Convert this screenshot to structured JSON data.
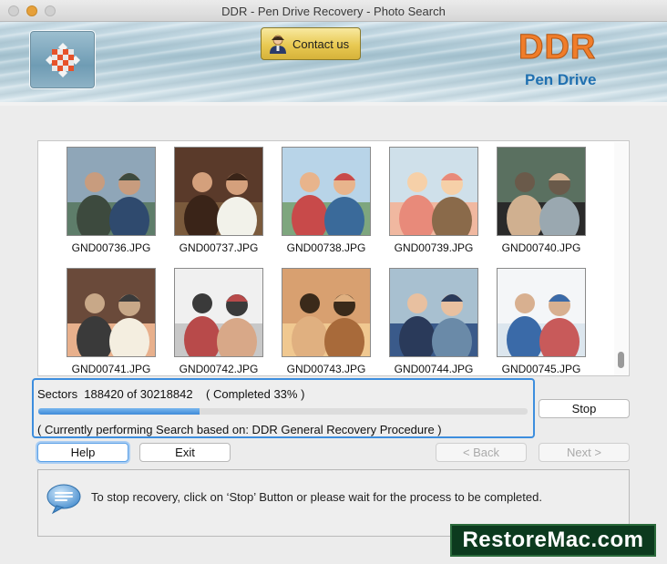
{
  "window": {
    "title": "DDR - Pen Drive Recovery - Photo Search"
  },
  "banner": {
    "contact_label": "Contact us",
    "brand": "DDR",
    "brand_sub": "Pen Drive"
  },
  "gallery": {
    "items": [
      {
        "label": "GND00736.JPG",
        "icon": "photo-two-men-outdoors"
      },
      {
        "label": "GND00737.JPG",
        "icon": "photo-smiling-woman"
      },
      {
        "label": "GND00738.JPG",
        "icon": "photo-group-friends"
      },
      {
        "label": "GND00739.JPG",
        "icon": "photo-elderly-couple-selfie"
      },
      {
        "label": "GND00740.JPG",
        "icon": "photo-group-posing"
      },
      {
        "label": "GND00741.JPG",
        "icon": "photo-couple-laughing"
      },
      {
        "label": "GND00742.JPG",
        "icon": "photo-friends-party"
      },
      {
        "label": "GND00743.JPG",
        "icon": "photo-couple-hug"
      },
      {
        "label": "GND00744.JPG",
        "icon": "photo-two-men-sitting"
      },
      {
        "label": "GND00745.JPG",
        "icon": "photo-friends-standing"
      }
    ]
  },
  "progress": {
    "sectors_text": "Sectors  188420 of 30218842    ( Completed 33% )",
    "fraction": 0.33,
    "status_text": "( Currently performing Search based on: DDR General Recovery Procedure )"
  },
  "buttons": {
    "stop": "Stop",
    "help": "Help",
    "exit": "Exit",
    "back": "< Back",
    "next": "Next >"
  },
  "info": {
    "text": "To stop recovery, click on ‘Stop’ Button or please wait for the process to be completed."
  },
  "watermark": "RestoreMac.com",
  "colors": {
    "accent": "#3d8ede",
    "brand_orange": "#f07d2a",
    "brand_blue": "#2070b0"
  }
}
